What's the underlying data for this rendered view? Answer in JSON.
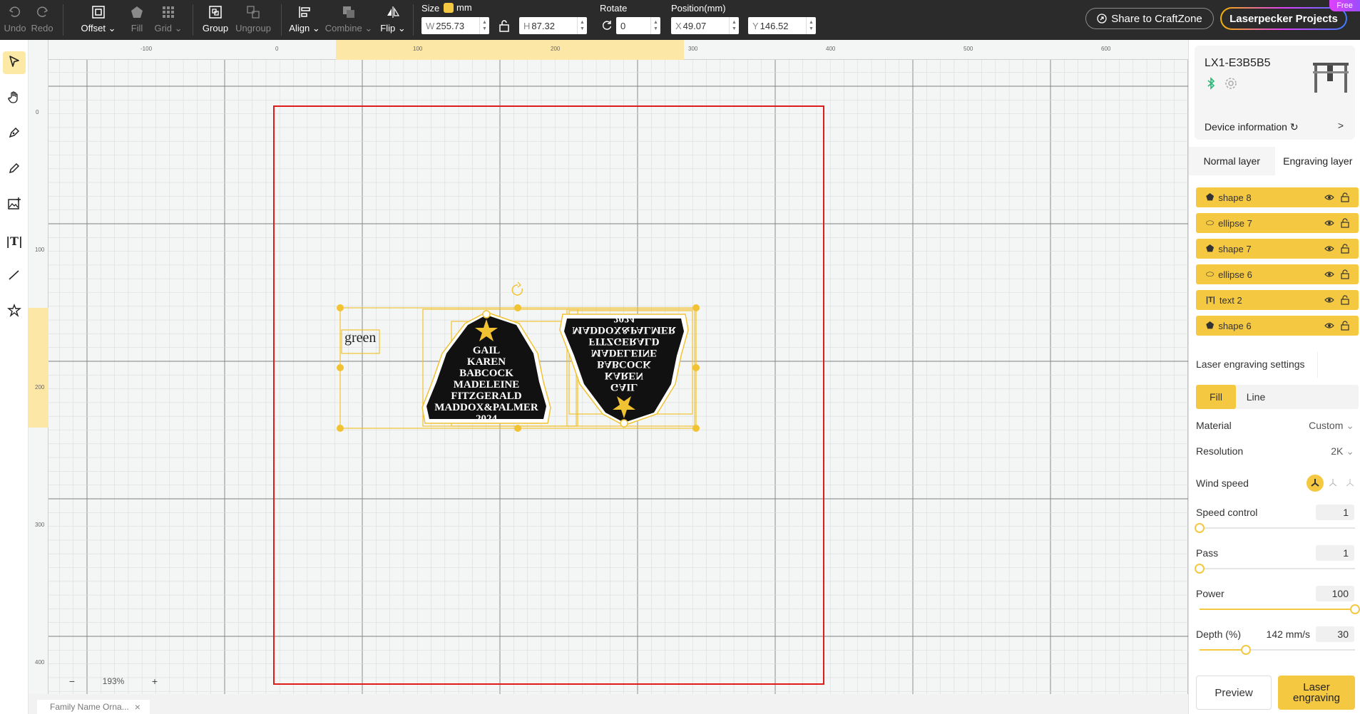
{
  "toolbar": {
    "undo": "Undo",
    "redo": "Redo",
    "offset": "Offset",
    "fill": "Fill",
    "grid": "Grid",
    "group": "Group",
    "ungroup": "Ungroup",
    "align": "Align",
    "combine": "Combine",
    "flip": "Flip",
    "size_label": "Size",
    "unit": "mm",
    "width_prefix": "W",
    "width": "255.73",
    "height_prefix": "H",
    "height": "87.32",
    "rotate_label": "Rotate",
    "rotate": "0",
    "position_label": "Position(mm)",
    "x_prefix": "X",
    "x": "49.07",
    "y_prefix": "Y",
    "y": "146.52",
    "share": "Share to CraftZone",
    "projects": "Laserpecker Projects",
    "free": "Free"
  },
  "tools": [
    "select-icon",
    "hand-icon",
    "pen-icon",
    "pencil-icon",
    "image-add-icon",
    "text-icon",
    "line-icon",
    "shapes-icon"
  ],
  "canvas": {
    "ruler_top": [
      "-100",
      "0",
      "100",
      "200",
      "300",
      "400",
      "500",
      "600"
    ],
    "ruler_left": [
      "0",
      "100",
      "200",
      "300",
      "400"
    ],
    "text_object": "green",
    "ornament_lines": [
      "GAIL",
      "KAREN",
      "BABCOCK",
      "MADELEINE",
      "FITZGERALD",
      "MADDOX&PALMER",
      "2024"
    ],
    "zoom": "193%",
    "zoom_minus": "−",
    "zoom_plus": "+",
    "file_tab": "Family Name Orna...",
    "file_close": "×"
  },
  "colors": {
    "accent": "#f5c842",
    "work_area": "#e01b1b",
    "selection": "#f1c232"
  },
  "device": {
    "name": "LX1-E3B5B5",
    "info": "Device information",
    "arrow": ">"
  },
  "layers": {
    "tabs": [
      "Normal layer",
      "Engraving layer"
    ],
    "items": [
      {
        "name": "shape 8",
        "type": "shape"
      },
      {
        "name": "ellipse 7",
        "type": "ellipse"
      },
      {
        "name": "shape 7",
        "type": "shape"
      },
      {
        "name": "ellipse 6",
        "type": "ellipse"
      },
      {
        "name": "text 2",
        "type": "text"
      },
      {
        "name": "shape 6",
        "type": "shape"
      }
    ]
  },
  "laser": {
    "title": "Laser engraving settings",
    "modes": [
      "Fill",
      "Line"
    ],
    "material_label": "Material",
    "material": "Custom",
    "resolution_label": "Resolution",
    "resolution": "2K",
    "wind_label": "Wind speed",
    "speed_label": "Speed control",
    "speed": "1",
    "speed_level": 0,
    "pass_label": "Pass",
    "pass": "1",
    "pass_level": 0,
    "power_label": "Power",
    "power": "100",
    "power_level": 1,
    "depth_label": "Depth (%)",
    "depth_speed": "142 mm/s",
    "depth": "30",
    "depth_level": 0.3,
    "preview": "Preview",
    "engrave": "Laser engraving"
  }
}
